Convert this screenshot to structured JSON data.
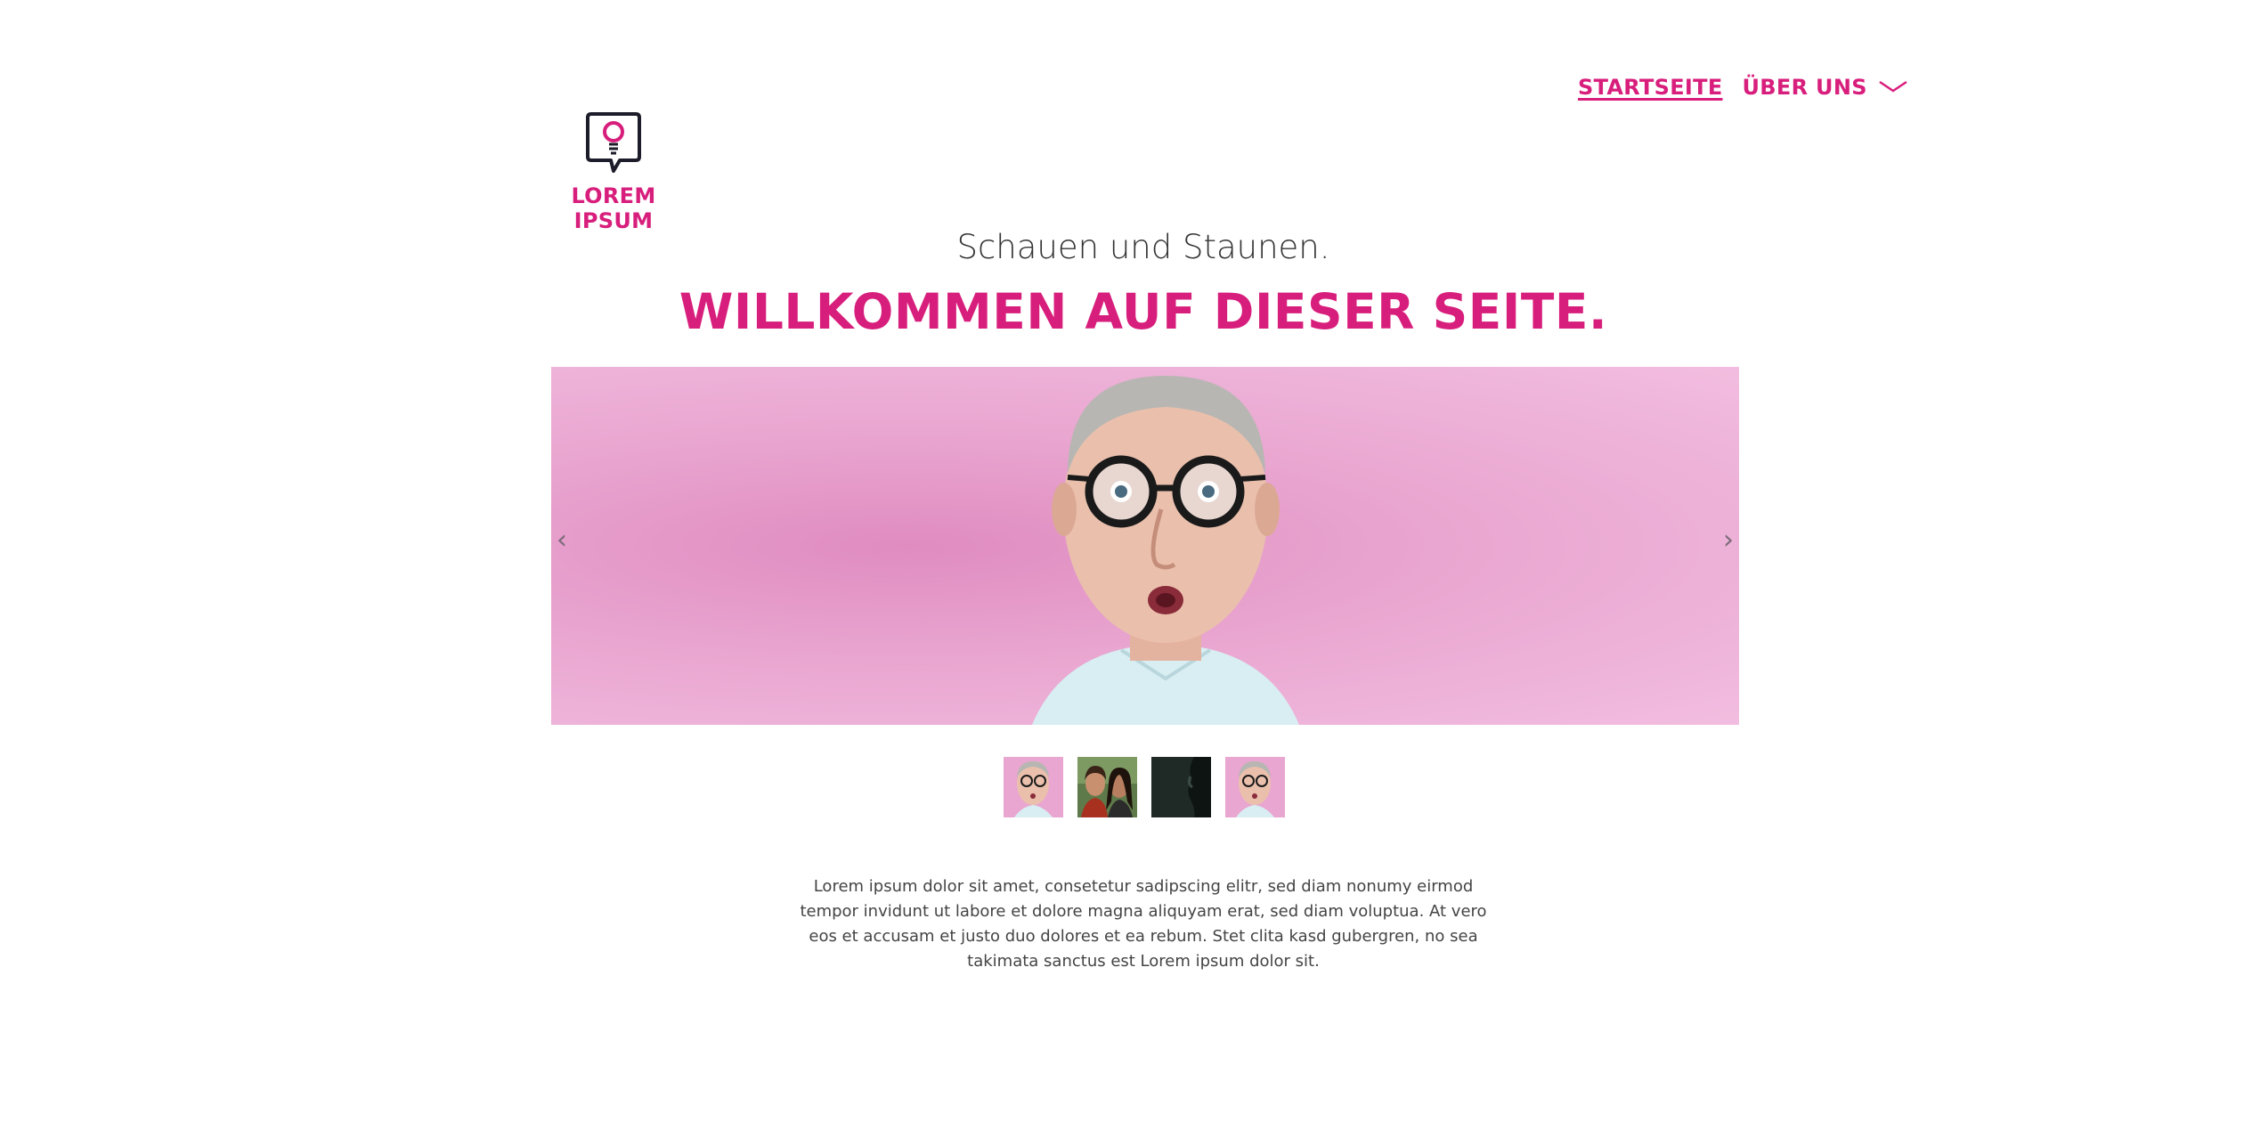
{
  "nav": {
    "items": [
      {
        "label": "STARTSEITE",
        "active": true
      },
      {
        "label": "ÜBER UNS",
        "has_dropdown": true
      }
    ]
  },
  "logo": {
    "text": "LOREM IPSUM",
    "icon": "lightbulb-speech-bubble-icon"
  },
  "hero": {
    "subtitle": "Schauen und Staunen.",
    "title": "WILLKOMMEN AUF DIESER SEITE."
  },
  "slider": {
    "prev_label": "‹",
    "next_label": "›",
    "slide_count": 4,
    "active_index": 0,
    "thumbnails": [
      {
        "name": "surprised-man-pink"
      },
      {
        "name": "two-women-green"
      },
      {
        "name": "dark-scene"
      },
      {
        "name": "surprised-man-pink"
      }
    ]
  },
  "content": {
    "text": "Lorem ipsum dolor sit amet, consetetur sadipscing elitr, sed diam nonumy eirmod tempor invidunt ut labore et dolore magna aliquyam erat, sed diam voluptua. At vero eos et accusam et justo duo dolores et ea rebum. Stet clita kasd gubergren, no sea takimata sanctus est Lorem ipsum dolor sit."
  },
  "colors": {
    "accent": "#d81e7c",
    "text": "#333333",
    "slide_bg": "#e9a6d0"
  }
}
